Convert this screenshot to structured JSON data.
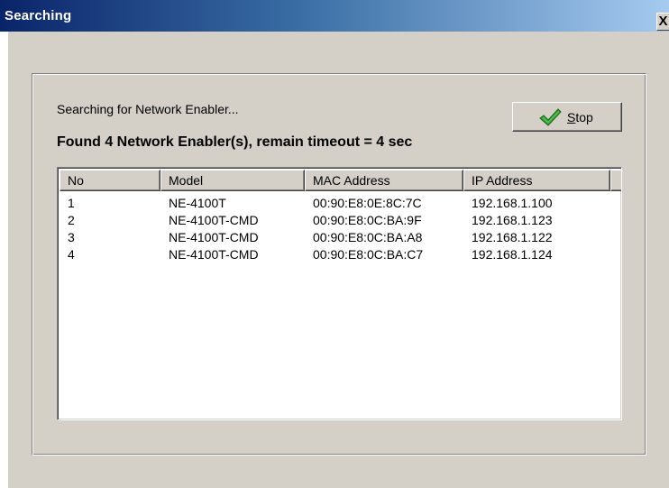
{
  "window": {
    "title": "Searching",
    "close_glyph": "X"
  },
  "status": {
    "searching_text": "Searching for Network Enabler...",
    "found_text": "Found 4 Network Enabler(s), remain timeout = 4 sec"
  },
  "stop_button": {
    "label_prefix": "S",
    "label_rest": "top",
    "icon": "green-checkmark-icon"
  },
  "table": {
    "columns": [
      "No",
      "Model",
      "MAC Address",
      "IP Address"
    ],
    "rows": [
      {
        "no": "1",
        "model": "NE-4100T",
        "mac": "00:90:E8:0E:8C:7C",
        "ip": "192.168.1.100"
      },
      {
        "no": "2",
        "model": "NE-4100T-CMD",
        "mac": "00:90:E8:0C:BA:9F",
        "ip": "192.168.1.123"
      },
      {
        "no": "3",
        "model": "NE-4100T-CMD",
        "mac": "00:90:E8:0C:BA:A8",
        "ip": "192.168.1.122"
      },
      {
        "no": "4",
        "model": "NE-4100T-CMD",
        "mac": "00:90:E8:0C:BA:C7",
        "ip": "192.168.1.124"
      }
    ]
  },
  "colors": {
    "titlebar_start": "#0a246a",
    "titlebar_end": "#a6caf0",
    "dialog_face": "#d4d0c8",
    "check_green": "#2e9a2e"
  }
}
